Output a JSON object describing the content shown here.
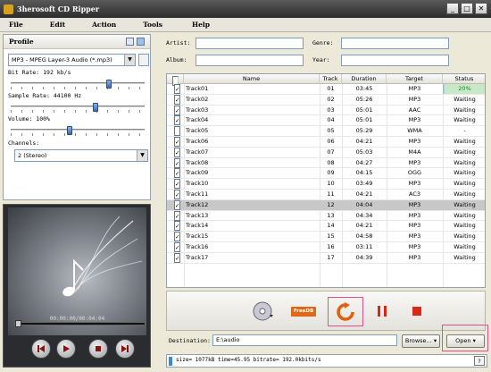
{
  "window": {
    "title": "3herosoft CD Ripper",
    "min": "_",
    "max": "□",
    "close": "✕"
  },
  "menu": [
    "File",
    "Edit",
    "Action",
    "Tools",
    "Help"
  ],
  "profile": {
    "header": "Profile",
    "format": "MP3 - MPEG Layer-3 Audio  (*.mp3)",
    "bitrate_label": "Bit Rate: 192 kb/s",
    "bitrate_level": 0.74,
    "samplerate_label": "Sample Rate: 44100 Hz",
    "samplerate_level": 0.64,
    "volume_label": "Volume: 100%",
    "volume_level": 0.44,
    "channels_label": "Channels:",
    "channels_value": "2 (Stereo)"
  },
  "player": {
    "timecode": "00:00:00/00:04:04",
    "progress": 0.0
  },
  "meta": {
    "artist_label": "Artist:",
    "album_label": "Album:",
    "genre_label": "Genre:",
    "year_label": "Year:"
  },
  "columns": [
    "Name",
    "Track",
    "Duration",
    "Target",
    "Status"
  ],
  "tracks": [
    {
      "name": "Track01",
      "track": "01",
      "dur": "03:45",
      "target": "MP3",
      "status": "20%",
      "checked": true,
      "progress": 0.2
    },
    {
      "name": "Track02",
      "track": "02",
      "dur": "05:26",
      "target": "MP3",
      "status": "Waiting",
      "checked": true
    },
    {
      "name": "Track03",
      "track": "03",
      "dur": "05:01",
      "target": "AAC",
      "status": "Waiting",
      "checked": true
    },
    {
      "name": "Track04",
      "track": "04",
      "dur": "05:01",
      "target": "MP3",
      "status": "Waiting",
      "checked": true
    },
    {
      "name": "Track05",
      "track": "05",
      "dur": "05:29",
      "target": "WMA",
      "status": "-",
      "checked": false
    },
    {
      "name": "Track06",
      "track": "06",
      "dur": "04:21",
      "target": "MP3",
      "status": "Waiting",
      "checked": true
    },
    {
      "name": "Track07",
      "track": "07",
      "dur": "05:03",
      "target": "M4A",
      "status": "Waiting",
      "checked": true
    },
    {
      "name": "Track08",
      "track": "08",
      "dur": "04:27",
      "target": "MP3",
      "status": "Waiting",
      "checked": true
    },
    {
      "name": "Track09",
      "track": "09",
      "dur": "04:15",
      "target": "OGG",
      "status": "Waiting",
      "checked": true
    },
    {
      "name": "Track10",
      "track": "10",
      "dur": "03:49",
      "target": "MP3",
      "status": "Waiting",
      "checked": true
    },
    {
      "name": "Track11",
      "track": "11",
      "dur": "04:21",
      "target": "AC3",
      "status": "Waiting",
      "checked": true
    },
    {
      "name": "Track12",
      "track": "12",
      "dur": "04:04",
      "target": "MP3",
      "status": "Waiting",
      "checked": true,
      "selected": true
    },
    {
      "name": "Track13",
      "track": "13",
      "dur": "04:34",
      "target": "MP3",
      "status": "Waiting",
      "checked": true
    },
    {
      "name": "Track14",
      "track": "14",
      "dur": "04:21",
      "target": "MP3",
      "status": "Waiting",
      "checked": true
    },
    {
      "name": "Track15",
      "track": "15",
      "dur": "04:58",
      "target": "MP3",
      "status": "Waiting",
      "checked": true
    },
    {
      "name": "Track16",
      "track": "16",
      "dur": "03:11",
      "target": "MP3",
      "status": "Waiting",
      "checked": true
    },
    {
      "name": "Track17",
      "track": "17",
      "dur": "04:39",
      "target": "MP3",
      "status": "Waiting",
      "checked": true
    }
  ],
  "toolbar": {
    "freedb": "FreeDB"
  },
  "destination": {
    "label": "Destination:",
    "value": "E:\\audio",
    "browse": "Browse...",
    "open": "Open"
  },
  "status": {
    "text": "size= 1077kB time=45.95 bitrate= 192.0kbits/s",
    "help": "?"
  }
}
